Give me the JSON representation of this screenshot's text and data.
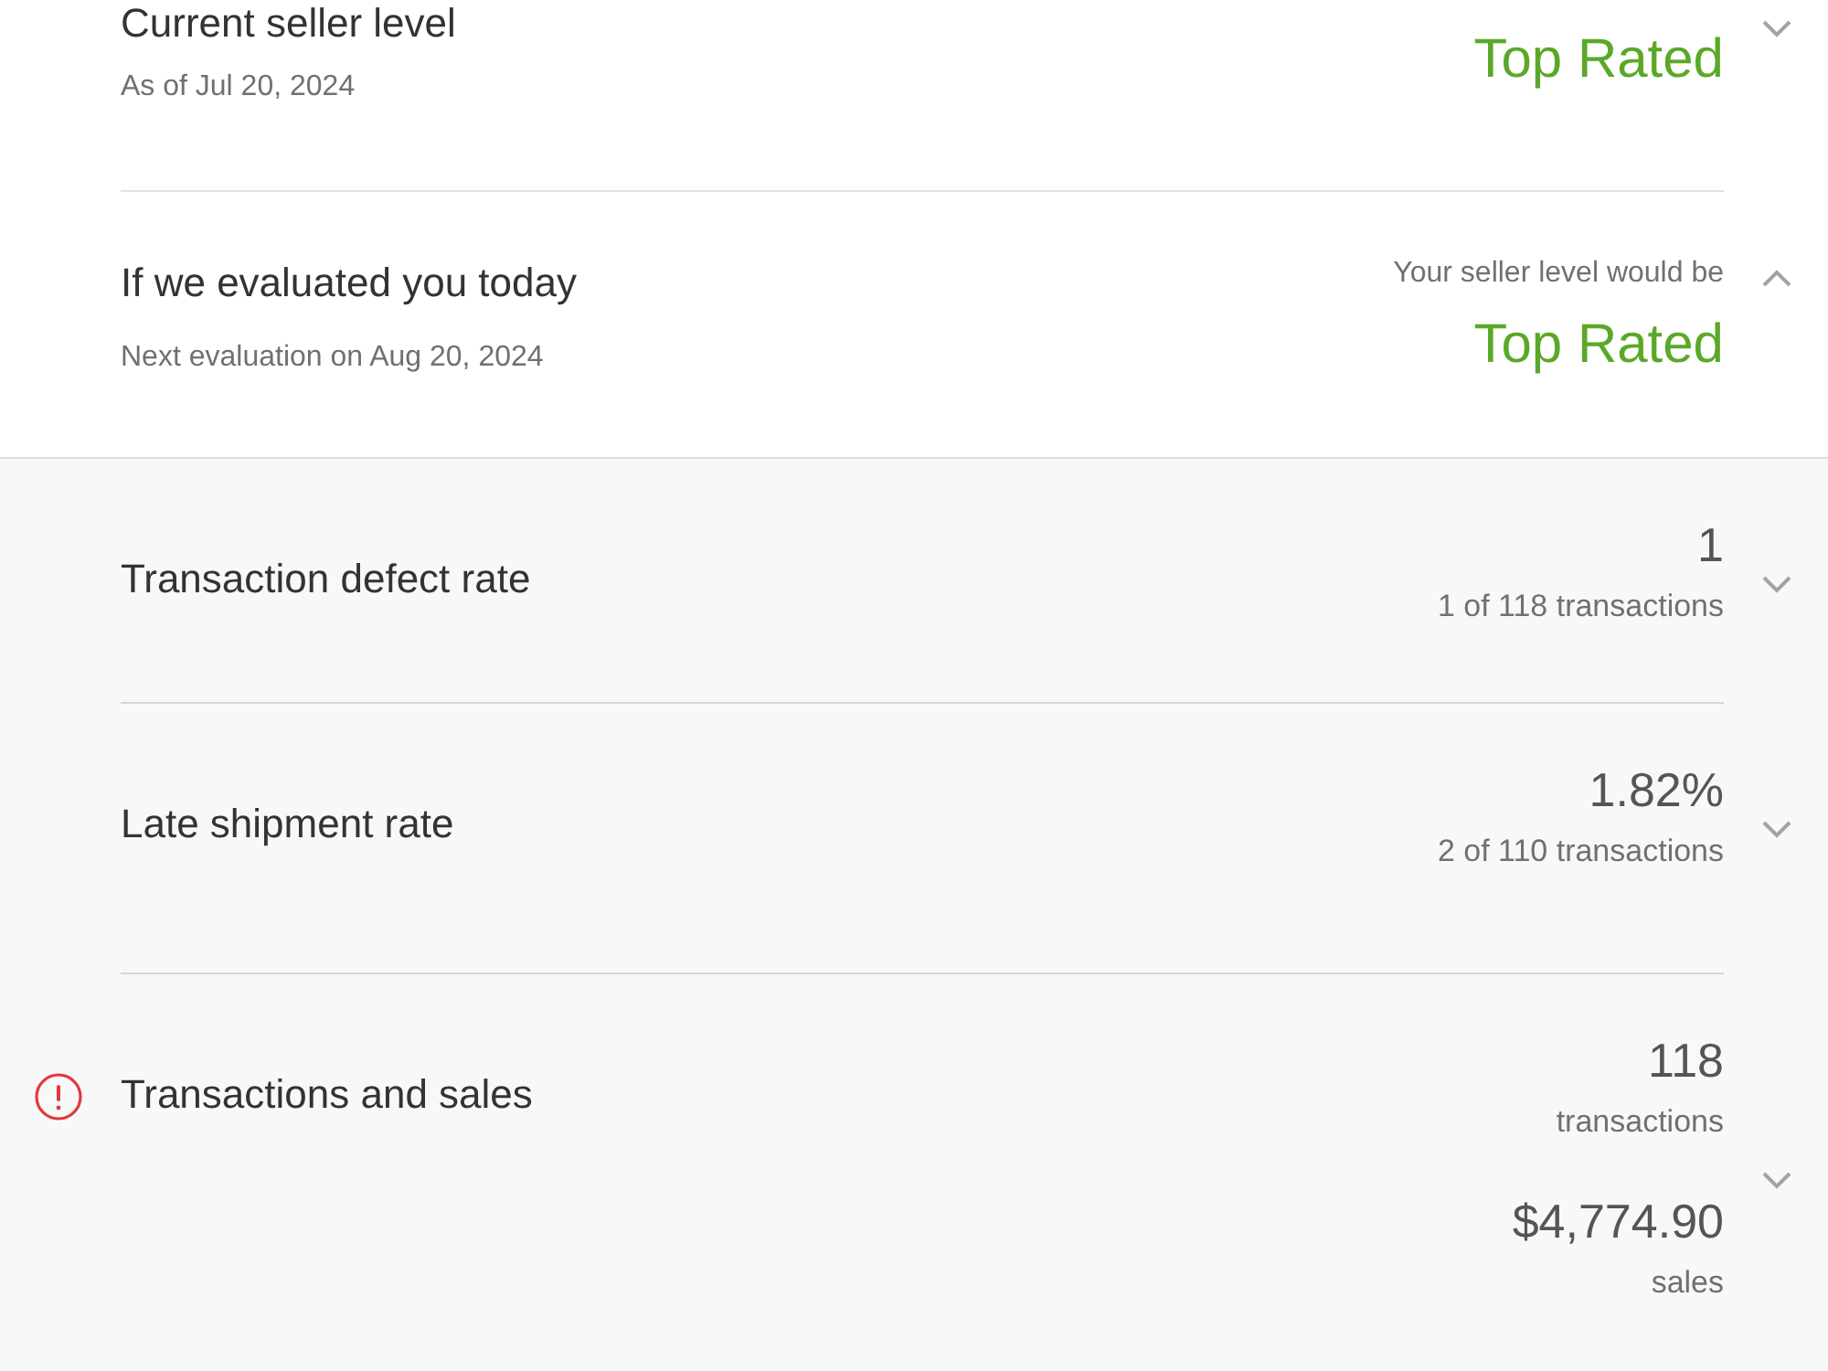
{
  "current_level": {
    "title": "Current seller level",
    "date": "As of Jul 20, 2024",
    "level": "Top Rated",
    "expanded": false
  },
  "projected_level": {
    "title": "If we evaluated you today",
    "date": "Next evaluation on Aug 20, 2024",
    "caption": "Your seller level would be",
    "level": "Top Rated",
    "expanded": true
  },
  "metrics": [
    {
      "label": "Transaction defect rate",
      "alert": false,
      "expanded": false,
      "figures": [
        {
          "value": "1",
          "caption": "1 of 118 transactions"
        }
      ]
    },
    {
      "label": "Late shipment rate",
      "alert": false,
      "expanded": false,
      "figures": [
        {
          "value": "1.82%",
          "caption": "2 of 110 transactions"
        }
      ]
    },
    {
      "label": "Transactions and sales",
      "alert": true,
      "expanded": false,
      "figures": [
        {
          "value": "118",
          "caption": "transactions"
        },
        {
          "value": "$4,774.90",
          "caption": "sales"
        }
      ]
    }
  ]
}
